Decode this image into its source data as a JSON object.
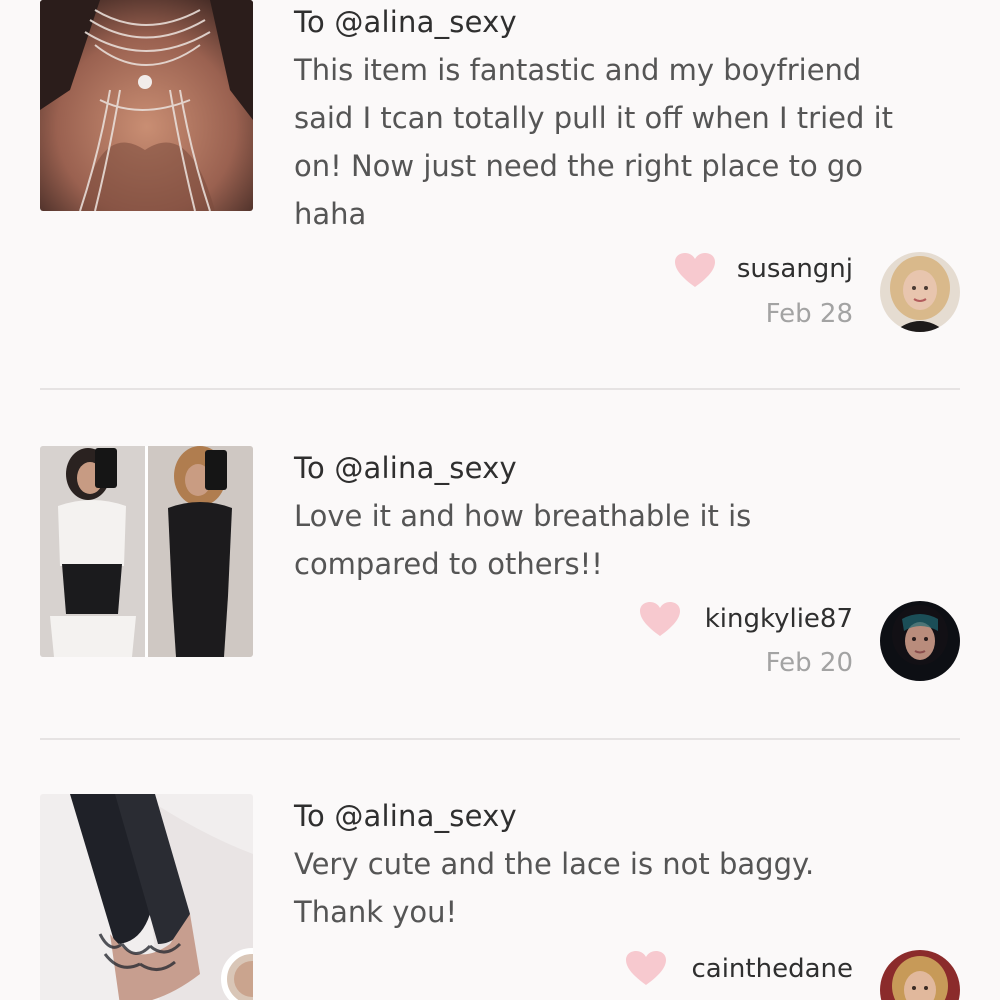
{
  "reviews": [
    {
      "recipient": "To @alina_sexy",
      "text_lines": [
        "This item is fantastic and my boyfriend",
        "said I tcan totally pull it off when I tried it",
        "on! Now just need the right place to go",
        "haha"
      ],
      "username": "susangnj",
      "date": "Feb 28",
      "photo_icon": "body-chain-jewelry-photo",
      "avatar_icon": "user-avatar-blonde"
    },
    {
      "recipient": "To @alina_sexy",
      "text_lines": [
        "Love it and how breathable it is",
        "compared to others!!"
      ],
      "username": "kingkylie87",
      "date": "Feb 20",
      "photo_icon": "waist-trainer-mirror-selfie-photo",
      "avatar_icon": "user-avatar-dark-hair"
    },
    {
      "recipient": "To @alina_sexy",
      "text_lines": [
        "Very cute and the lace is not baggy.",
        "Thank you!"
      ],
      "username": "cainthedane",
      "date": "",
      "photo_icon": "lace-stockings-photo",
      "avatar_icon": "user-avatar-blonde-2"
    }
  ],
  "colors": {
    "background": "#fbf9f9",
    "heart": "#f7c9cf",
    "divider": "#e6e3e3",
    "title_text": "#2f2f2f",
    "body_text": "#555555",
    "date_text": "#a3a3a3"
  },
  "icons": {
    "like": "heart-icon"
  }
}
